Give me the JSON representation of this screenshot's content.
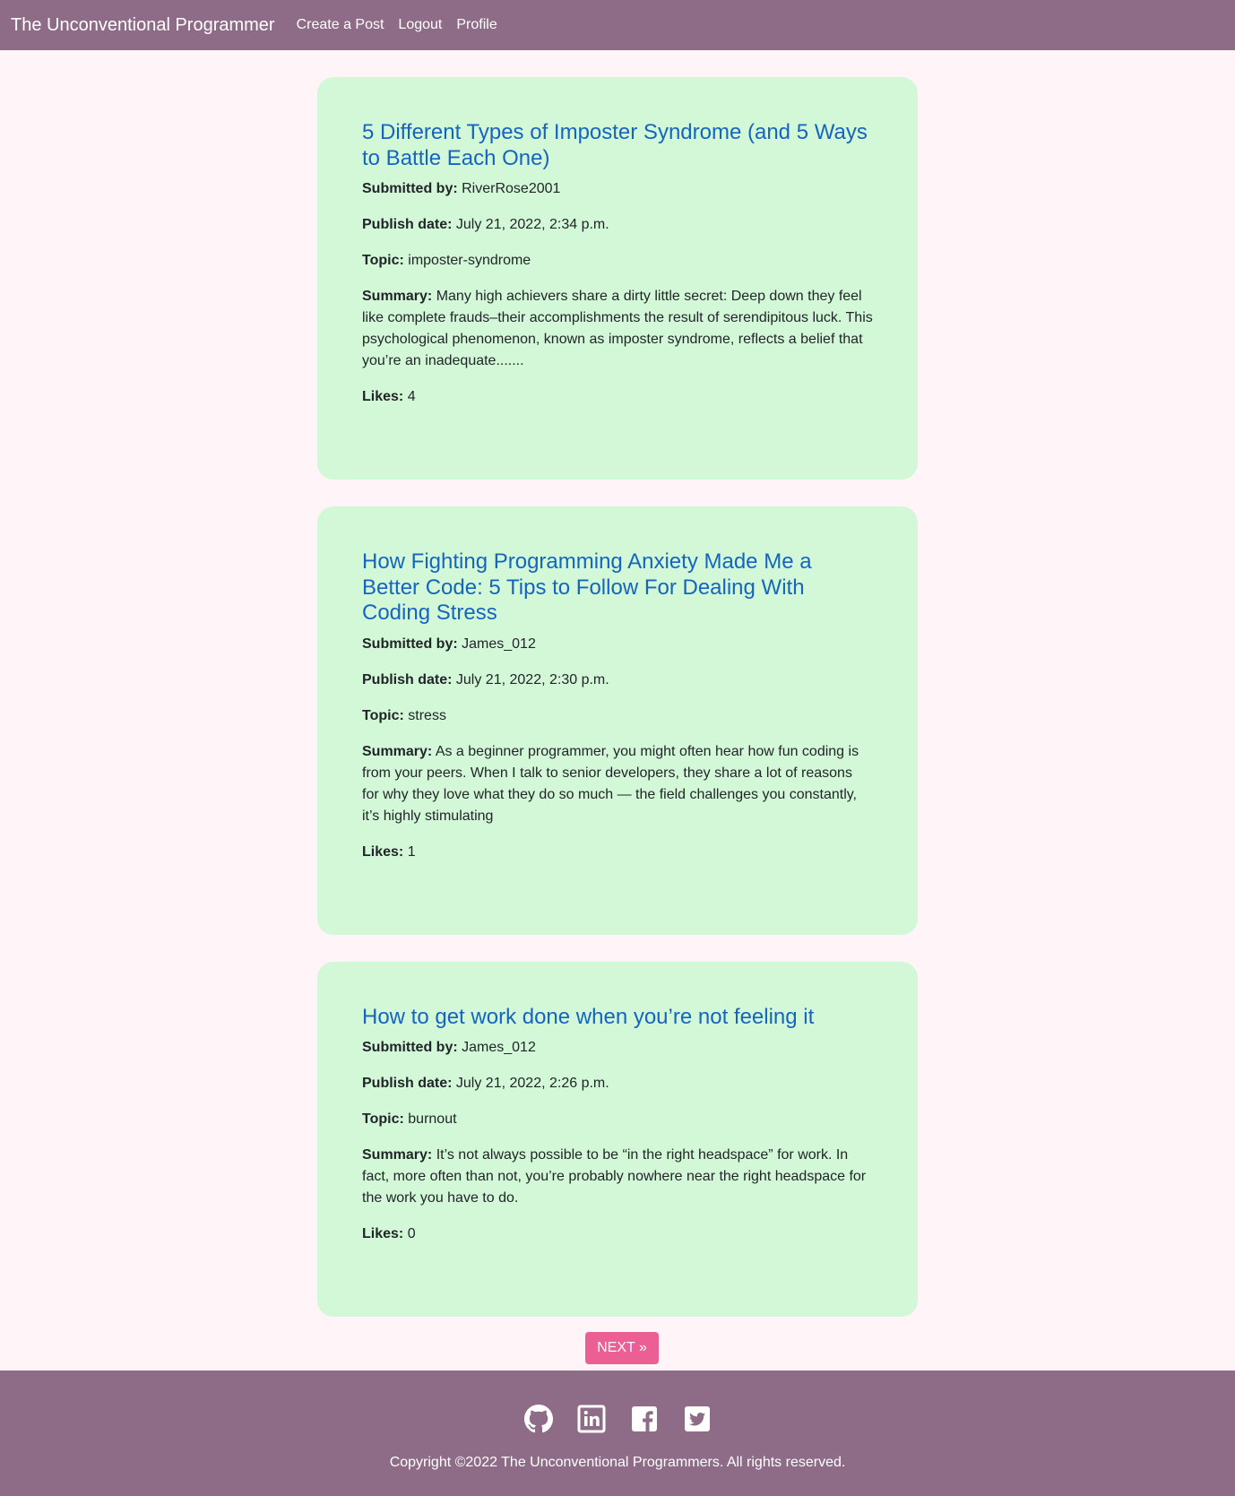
{
  "navbar": {
    "brand": "The Unconventional Programmer",
    "links": [
      "Create a Post",
      "Logout",
      "Profile"
    ]
  },
  "labels": {
    "submitted_by": "Submitted by:",
    "publish_date": "Publish date:",
    "topic": "Topic:",
    "summary": "Summary:",
    "likes": "Likes:"
  },
  "posts": [
    {
      "title": "5 Different Types of Imposter Syndrome (and 5 Ways to Battle Each One)",
      "author": "RiverRose2001",
      "date": "July 21, 2022, 2:34 p.m.",
      "topic": "imposter-syndrome",
      "summary": "Many high achievers share a dirty little secret: Deep down they feel like complete frauds–their accomplishments the result of serendipitous luck. This psychological phenomenon, known as imposter syndrome, reflects a belief that you’re an inadequate.......",
      "likes": "4"
    },
    {
      "title": "How Fighting Programming Anxiety Made Me a Better Code: 5 Tips to Follow For Dealing With Coding Stress",
      "author": "James_012",
      "date": "July 21, 2022, 2:30 p.m.",
      "topic": "stress",
      "summary": "As a beginner programmer, you might often hear how fun coding is from your peers. When I talk to senior developers, they share a lot of reasons for why they love what they do so much — the field challenges you constantly, it’s highly stimulating",
      "likes": "1"
    },
    {
      "title": "How to get work done when you’re not feeling it",
      "author": "James_012",
      "date": "July 21, 2022, 2:26 p.m.",
      "topic": "burnout",
      "summary": "It’s not always possible to be “in the right headspace” for work. In fact, more often than not, you’re probably nowhere near the right headspace for the work you have to do.",
      "likes": "0"
    }
  ],
  "pagination": {
    "next_label": "NEXT »"
  },
  "footer": {
    "social_icons": [
      "github-icon",
      "linkedin-icon",
      "facebook-icon",
      "twitter-icon"
    ],
    "copyright": "Copyright ©2022 The Unconventional Programmers. All rights reserved."
  },
  "colors": {
    "navbar": "#8e6c88",
    "background": "#fff4f7",
    "card": "#d3f8d7",
    "title_link": "#1565c0",
    "next_button": "#ec5f95"
  }
}
